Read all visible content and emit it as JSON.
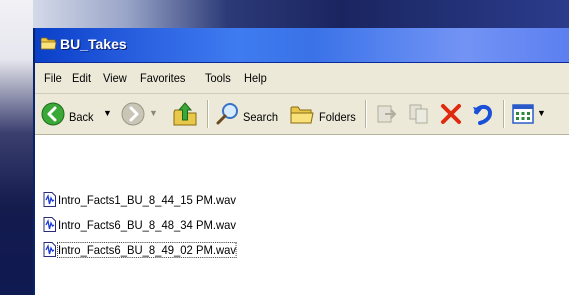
{
  "window": {
    "title": "BU_Takes"
  },
  "menu": {
    "items": [
      "File",
      "Edit",
      "View",
      "Favorites",
      "Tools",
      "Help"
    ]
  },
  "toolbar": {
    "back_label": "Back",
    "search_label": "Search",
    "folders_label": "Folders"
  },
  "files": [
    {
      "name": "Intro_Facts1_BU_8_44_15 PM.wav",
      "selected": false
    },
    {
      "name": "Intro_Facts6_BU_8_48_34 PM.wav",
      "selected": false
    },
    {
      "name": "Intro_Facts6_BU_8_49_02 PM.wav",
      "selected": true
    }
  ],
  "colors": {
    "titlebar": "#2a61e0",
    "chrome": "#ece9d8",
    "back_green": "#3aa836",
    "delete_red": "#e02a10",
    "undo_blue": "#1a4fd8"
  },
  "icons": {
    "title": "folder-icon",
    "file": "wav-audio-file-icon"
  }
}
